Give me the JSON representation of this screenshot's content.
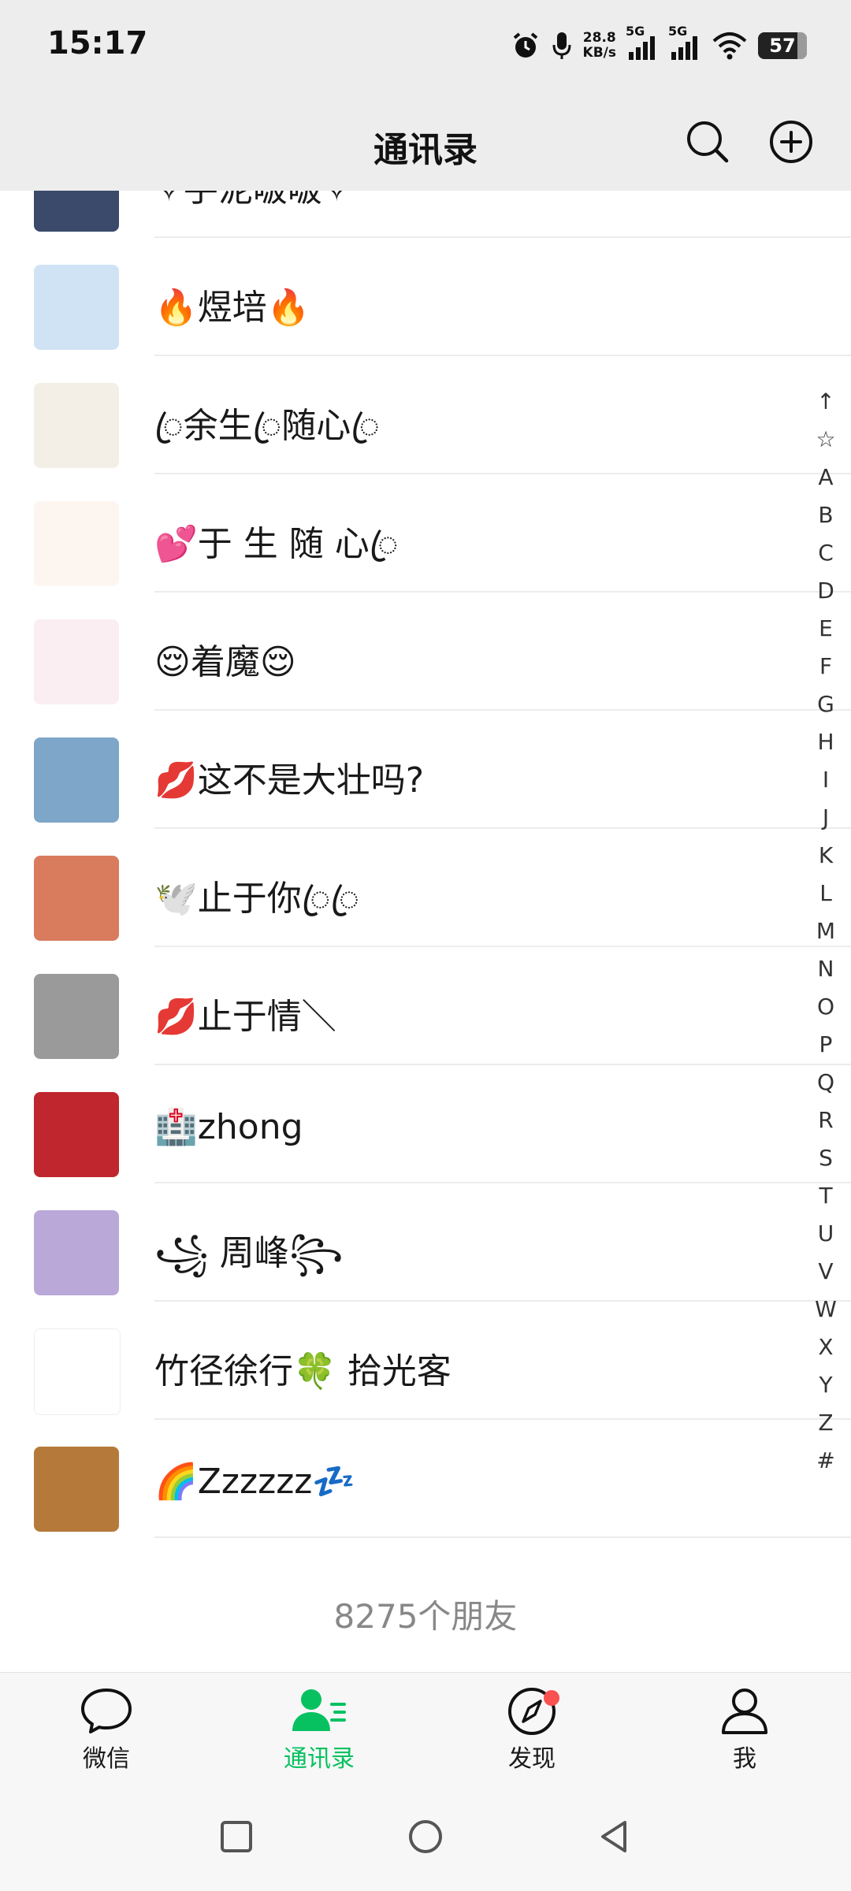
{
  "status_bar": {
    "time": "15:17",
    "net_speed_value": "28.8",
    "net_speed_unit": "KB/s",
    "sim1_tag": "5G",
    "sim2_tag": "5G",
    "battery": "57",
    "icons": [
      "alarm-icon",
      "mic-icon",
      "signal-icon",
      "wifi-icon",
      "battery-icon"
    ]
  },
  "header": {
    "title": "通讯录",
    "icons": [
      "search-icon",
      "add-icon"
    ]
  },
  "contacts": [
    {
      "name": "✧手泥啵啵✧",
      "avatar_color": "#3b4a6a"
    },
    {
      "name": "🔥煜培🔥",
      "avatar_color": "#cfe3f5"
    },
    {
      "name": "◌ꦿ余生ꦿ随心ꦿ",
      "avatar_color": "#f4efe6"
    },
    {
      "name": "💕于 生 随 心ꦿ",
      "avatar_color": "#fdf5f0"
    },
    {
      "name": "😌着魔😌",
      "avatar_color": "#fbeef2"
    },
    {
      "name": "💋这不是大壮吗?",
      "avatar_color": "#7da6c9"
    },
    {
      "name": "🕊️止于你ꦿꦿ",
      "avatar_color": "#d97b5d"
    },
    {
      "name": "💋止于情＼",
      "avatar_color": "#9a9a9a"
    },
    {
      "name": "🏥zhong",
      "avatar_color": "#c0262d"
    },
    {
      "name": "꧁ 周峰꧂",
      "avatar_color": "#b9a8d8"
    },
    {
      "name": " 竹径徐行🍀 拾光客",
      "avatar_color": "#ffffff"
    },
    {
      "name": "🌈Zzzzzz💤",
      "avatar_color": "#b57a3a"
    }
  ],
  "footer": {
    "friend_count": "8275个朋友"
  },
  "index_bar": [
    "↑",
    "☆",
    "A",
    "B",
    "C",
    "D",
    "E",
    "F",
    "G",
    "H",
    "I",
    "J",
    "K",
    "L",
    "M",
    "N",
    "O",
    "P",
    "Q",
    "R",
    "S",
    "T",
    "U",
    "V",
    "W",
    "X",
    "Y",
    "Z",
    "#"
  ],
  "tabs": [
    {
      "label": "微信",
      "icon": "chat-icon",
      "active": false
    },
    {
      "label": "通讯录",
      "icon": "contacts-icon",
      "active": true
    },
    {
      "label": "发现",
      "icon": "compass-icon",
      "active": false,
      "badge": true
    },
    {
      "label": "我",
      "icon": "person-icon",
      "active": false
    }
  ],
  "system_nav": [
    "recents-icon",
    "home-icon",
    "back-icon"
  ],
  "colors": {
    "accent": "#07c160",
    "badge": "#fa5151",
    "header_bg": "#ededed"
  }
}
